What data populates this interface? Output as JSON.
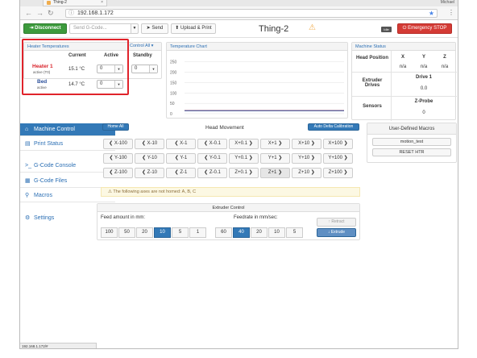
{
  "browser": {
    "tab_title": "Thing-2",
    "user": "Michael",
    "url": "192.168.1.172",
    "status_url": "192.168.1.172/#"
  },
  "toolbar": {
    "disconnect": "Disconnect",
    "gcode_placeholder": "Send G-Code...",
    "send": "Send",
    "upload_print": "Upload & Print",
    "machine_name": "Thing-2",
    "status_badge": "Idle",
    "emergency": "Emergency STOP"
  },
  "heaters": {
    "title": "Heater Temperatures",
    "control_all": "Control All",
    "columns": [
      "Current",
      "Active",
      "Standby"
    ],
    "rows": [
      {
        "name": "Heater 1",
        "sub": "active (T0)",
        "current": "15.1 °C",
        "active": "0",
        "standby": "0"
      },
      {
        "name": "Bed",
        "sub": "active",
        "current": "14.7 °C",
        "active": "0"
      }
    ]
  },
  "chart": {
    "title": "Temperature Chart"
  },
  "chart_data": {
    "type": "line",
    "title": "Temperature Chart",
    "ylim": [
      0,
      280
    ],
    "yticks": [
      0,
      50,
      100,
      150,
      200,
      250
    ],
    "series": [
      {
        "values": [
          15,
          15,
          15,
          15,
          15,
          15,
          15,
          15,
          15,
          15
        ],
        "color": "#d9222a"
      },
      {
        "values": [
          14.7,
          14.7,
          14.7,
          14.7,
          14.7,
          14.7,
          14.7,
          14.7,
          14.7,
          14.7
        ],
        "color": "#2b4f9a"
      }
    ]
  },
  "machine_status": {
    "title": "Machine Status",
    "head_position": "Head Position",
    "axes": [
      "X",
      "Y",
      "Z"
    ],
    "values": [
      "n/a",
      "n/a",
      "n/a"
    ],
    "extruder_drives": "Extruder Drives",
    "drive_label": "Drive 1",
    "drive_value": "0.0",
    "sensors": "Sensors",
    "probe_label": "Z-Probe",
    "probe_value": "0"
  },
  "sidebar": {
    "items": [
      {
        "label": "Machine Control",
        "icon": "home-icon"
      },
      {
        "label": "Print Status",
        "icon": "status-icon"
      },
      {
        "label": "G-Code Console",
        "icon": "console-icon"
      },
      {
        "label": "G-Code Files",
        "icon": "files-icon"
      },
      {
        "label": "Macros",
        "icon": "macros-icon"
      },
      {
        "label": "Settings",
        "icon": "settings-icon"
      }
    ]
  },
  "head_movement": {
    "home_all": "Home All",
    "title": "Head Movement",
    "auto_calibration": "Auto Delta Calibration",
    "rows": [
      [
        "X-100",
        "X-10",
        "X-1",
        "X-0.1",
        "X+0.1",
        "X+1",
        "X+10",
        "X+100"
      ],
      [
        "Y-100",
        "Y-10",
        "Y-1",
        "Y-0.1",
        "Y+0.1",
        "Y+1",
        "Y+10",
        "Y+100"
      ],
      [
        "Z-100",
        "Z-10",
        "Z-1",
        "Z-0.1",
        "Z+0.1",
        "Z+1",
        "Z+10",
        "Z+100"
      ]
    ],
    "hint": "The following axes are not homed: A, B, C"
  },
  "extruder": {
    "title": "Extruder Control",
    "feed_label": "Feed amount in mm:",
    "feed_values": [
      "100",
      "50",
      "20",
      "10",
      "5",
      "1"
    ],
    "feed_selected": "10",
    "rate_label": "Feedrate in mm/sec:",
    "rate_values": [
      "60",
      "40",
      "20",
      "10",
      "5"
    ],
    "rate_selected": "40",
    "retract": "Retract",
    "extrude": "Extrude"
  },
  "macros": {
    "title": "User-Defined Macros",
    "items": [
      "motion_test",
      "RESET HTR"
    ]
  }
}
